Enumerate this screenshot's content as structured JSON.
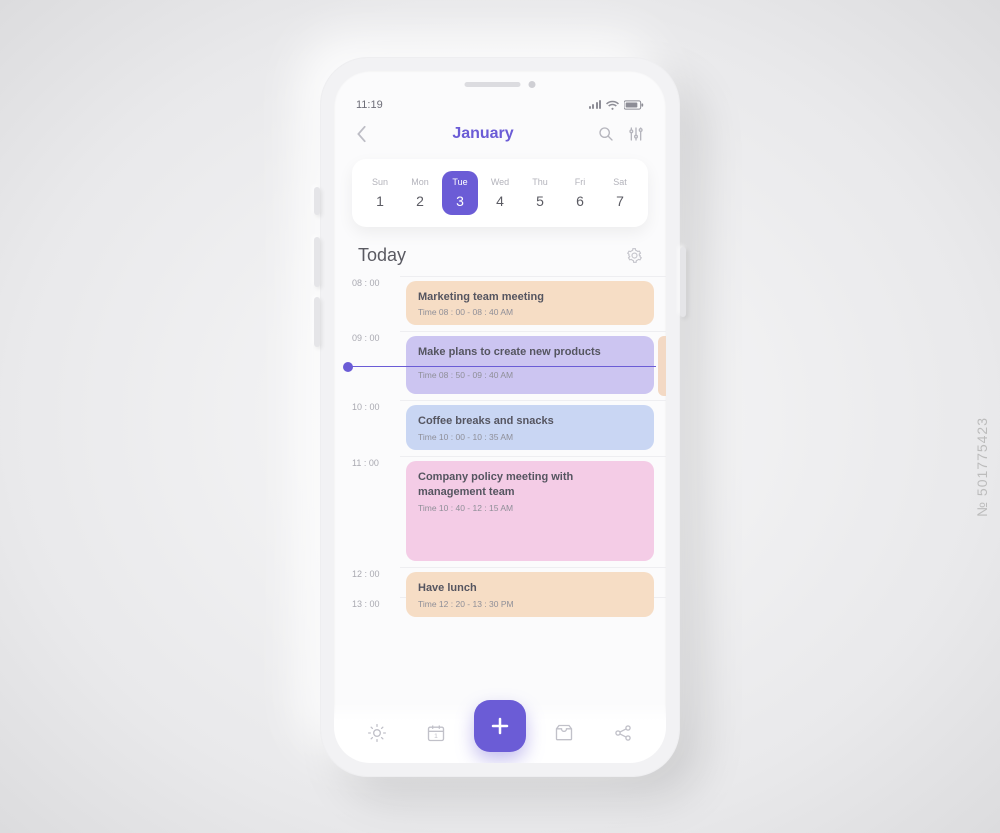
{
  "status": {
    "time": "11:19"
  },
  "header": {
    "title": "January"
  },
  "watermark": "№ 501775423",
  "week": {
    "days": [
      {
        "dow": "Sun",
        "num": "1",
        "selected": false
      },
      {
        "dow": "Mon",
        "num": "2",
        "selected": false
      },
      {
        "dow": "Tue",
        "num": "3",
        "selected": true
      },
      {
        "dow": "Wed",
        "num": "4",
        "selected": false
      },
      {
        "dow": "Thu",
        "num": "5",
        "selected": false
      },
      {
        "dow": "Fri",
        "num": "6",
        "selected": false
      },
      {
        "dow": "Sat",
        "num": "7",
        "selected": false
      }
    ]
  },
  "section": {
    "title": "Today"
  },
  "timeline": {
    "hours": [
      "08 : 00",
      "09 : 00",
      "10 : 00",
      "11 : 00",
      "12 : 00",
      "13 : 00"
    ],
    "events": [
      {
        "title": "Marketing team meeting",
        "time": "Time 08 : 00 - 08 : 40 AM",
        "color": "ev-orange"
      },
      {
        "title": "Make plans to create new products",
        "time": "Time 08 : 50 - 09 : 40 AM",
        "color": "ev-purple"
      },
      {
        "title": "Coffee breaks and snacks",
        "time": "Time 10 : 00 - 10 : 35 AM",
        "color": "ev-blue"
      },
      {
        "title": "Company policy meeting with management team",
        "time": "Time 10 : 40 - 12 : 15 AM",
        "color": "ev-pink"
      },
      {
        "title": "Have lunch",
        "time": "Time 12 : 20 - 13 : 30 PM",
        "color": "ev-orange"
      }
    ]
  },
  "colors": {
    "accent": "#6b5cd6"
  }
}
